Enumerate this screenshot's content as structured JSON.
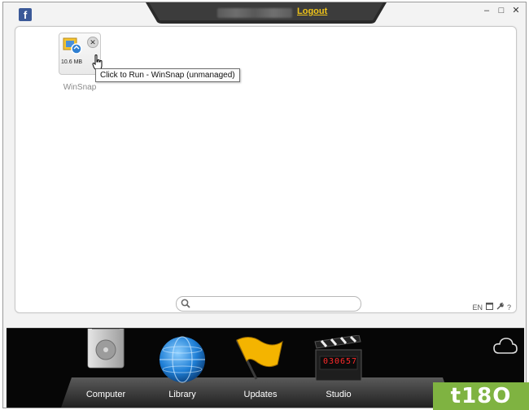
{
  "topbar": {
    "logout_label": "Logout",
    "facebook_letter": "f",
    "window_buttons": [
      "–",
      "□",
      "✕"
    ]
  },
  "app_tile": {
    "size_label": "10.6 MB",
    "name": "WinSnap",
    "remove_symbol": "✕",
    "tooltip": "Click to Run - WinSnap (unmanaged)"
  },
  "footer": {
    "language": "EN",
    "help": "?"
  },
  "dock": {
    "items": [
      {
        "label": "Computer",
        "icon": "hard-drive-icon"
      },
      {
        "label": "Library",
        "icon": "globe-icon"
      },
      {
        "label": "Updates",
        "icon": "flag-icon"
      },
      {
        "label": "Studio",
        "icon": "clapperboard-icon",
        "display": "030657"
      }
    ]
  },
  "watermark": "t18O",
  "colors": {
    "logout": "#f0c419",
    "dock_background": "#060606",
    "watermark": "#7fb341"
  }
}
